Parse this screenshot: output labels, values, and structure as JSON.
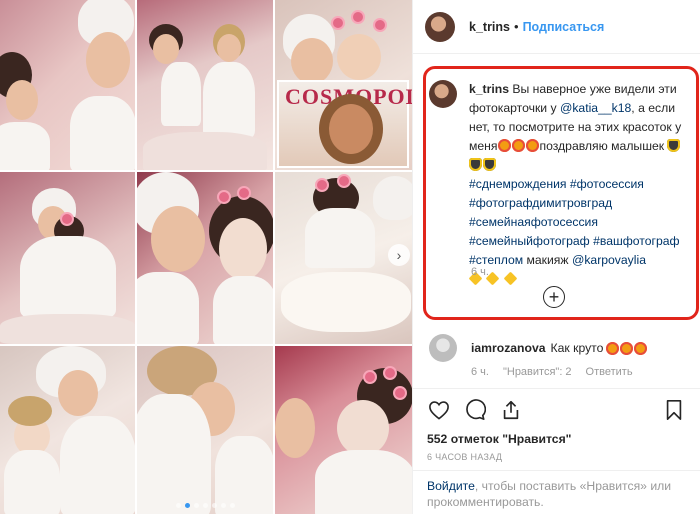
{
  "header": {
    "username": "k_trins",
    "separator": "•",
    "follow_label": "Подписаться"
  },
  "caption": {
    "username": "k_trins",
    "text_1": "Вы наверное уже видели эти фотокарточки у",
    "mention_1": "@katia__k18",
    "text_2": ", а если нет, то посмотрите на этих красоток у меня",
    "text_3": "поздравляю малышек",
    "hashtags_line_1": "#сднемрождения #фотосессия",
    "hashtags_line_2": "#фотографдимитровград",
    "hashtags_line_3": "#семейнаяфотосессия",
    "hashtags_line_4a": "#семейныйфотограф",
    "hashtags_line_4b": "#вашфотограф",
    "hashtags_line_5a": "#степлом",
    "text_4": "макияж",
    "mention_2": "@karpovaylia",
    "time": "6 ч."
  },
  "comment": {
    "username": "iamrozanova",
    "text": "Как круто",
    "time": "6 ч.",
    "likes": "\"Нравится\": 2",
    "reply": "Ответить"
  },
  "post": {
    "likes_count": "552 отметок \"Нравится\"",
    "time_ago": "6 ЧАСОВ НАЗАД"
  },
  "login_prompt": {
    "link": "Войдите",
    "text": ", чтобы поставить «Нравится» или прокомментировать."
  },
  "gallery": {
    "magazine_title": "COSMOPOLITAN",
    "carousel_dots": 7,
    "active_dot": 2
  },
  "colors": {
    "highlight_border": "#e1251b",
    "link_blue": "#3897f0",
    "dark_link": "#003569"
  },
  "icons": [
    "heart-icon",
    "comment-icon",
    "share-icon",
    "bookmark-icon",
    "add-comment-icon",
    "chevron-right-icon"
  ]
}
